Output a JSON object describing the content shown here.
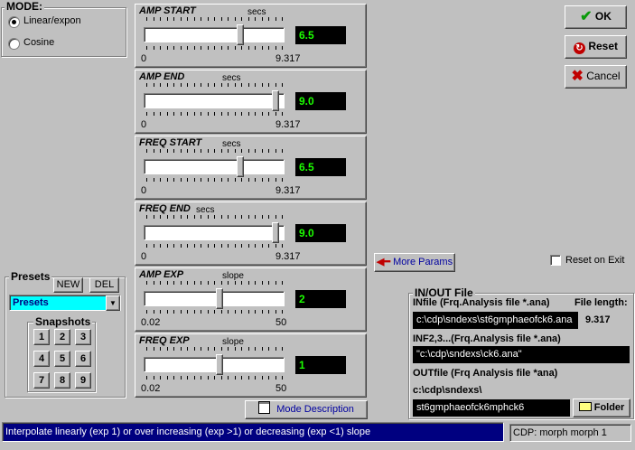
{
  "mode": {
    "title": "MODE:",
    "options": [
      {
        "label": "Linear/expon",
        "selected": true
      },
      {
        "label": "Cosine",
        "selected": false
      }
    ]
  },
  "params": [
    {
      "title": "AMP START",
      "unit": "secs",
      "value": "6.5",
      "min": "0",
      "max": "9.317",
      "fraction": 0.698
    },
    {
      "title": "AMP END",
      "unit": "secs",
      "value": "9.0",
      "min": "0",
      "max": "9.317",
      "fraction": 0.966
    },
    {
      "title": "FREQ START",
      "unit": "secs",
      "value": "6.5",
      "min": "0",
      "max": "9.317",
      "fraction": 0.698
    },
    {
      "title": "FREQ END",
      "unit": "secs",
      "value": "9.0",
      "min": "0",
      "max": "9.317",
      "fraction": 0.966
    },
    {
      "title": "AMP EXP",
      "unit": "slope",
      "value": "2",
      "min": "0.02",
      "max": "50",
      "fraction": 0.54
    },
    {
      "title": "FREQ EXP",
      "unit": "slope",
      "value": "1",
      "min": "0.02",
      "max": "50",
      "fraction": 0.54
    }
  ],
  "buttons": {
    "ok": "OK",
    "reset": "Reset",
    "cancel": "Cancel",
    "more_params": "More Params",
    "mode_description": "Mode Description",
    "folder": "Folder"
  },
  "reset_on_exit": {
    "label": "Reset on Exit",
    "checked": false
  },
  "presets": {
    "title": "Presets",
    "new_label": "NEW",
    "del_label": "DEL",
    "selected": "Presets",
    "snapshots_title": "Snapshots",
    "snapshots": [
      "1",
      "2",
      "3",
      "4",
      "5",
      "6",
      "7",
      "8",
      "9"
    ]
  },
  "inout": {
    "title": "IN/OUT File",
    "infile_label": "INfile (Frq.Analysis file *.ana)",
    "file_length_label": "File length:",
    "infile_value": "c:\\cdp\\sndexs\\st6gmphaeofck6.ana",
    "file_length_value": "9.317",
    "inf23_label": "INF2,3...(Frq.Analysis file *.ana)",
    "inf23_value": "\"c:\\cdp\\sndexs\\ck6.ana\"",
    "outfile_label": "OUTfile (Frq Analysis file *ana)",
    "out_dir": "c:\\cdp\\sndexs\\",
    "outfile_value": "st6gmphaeofck6mphck6"
  },
  "status": {
    "message": "Interpolate linearly (exp 1) or over  increasing (exp >1) or decreasing (exp <1) slope",
    "cdp": "CDP: morph morph 1"
  },
  "colors": {
    "value_text": "#1cff00",
    "preset_combo": "#00ffff",
    "status_bg": "#000080",
    "file_field_bg": "#000000"
  }
}
